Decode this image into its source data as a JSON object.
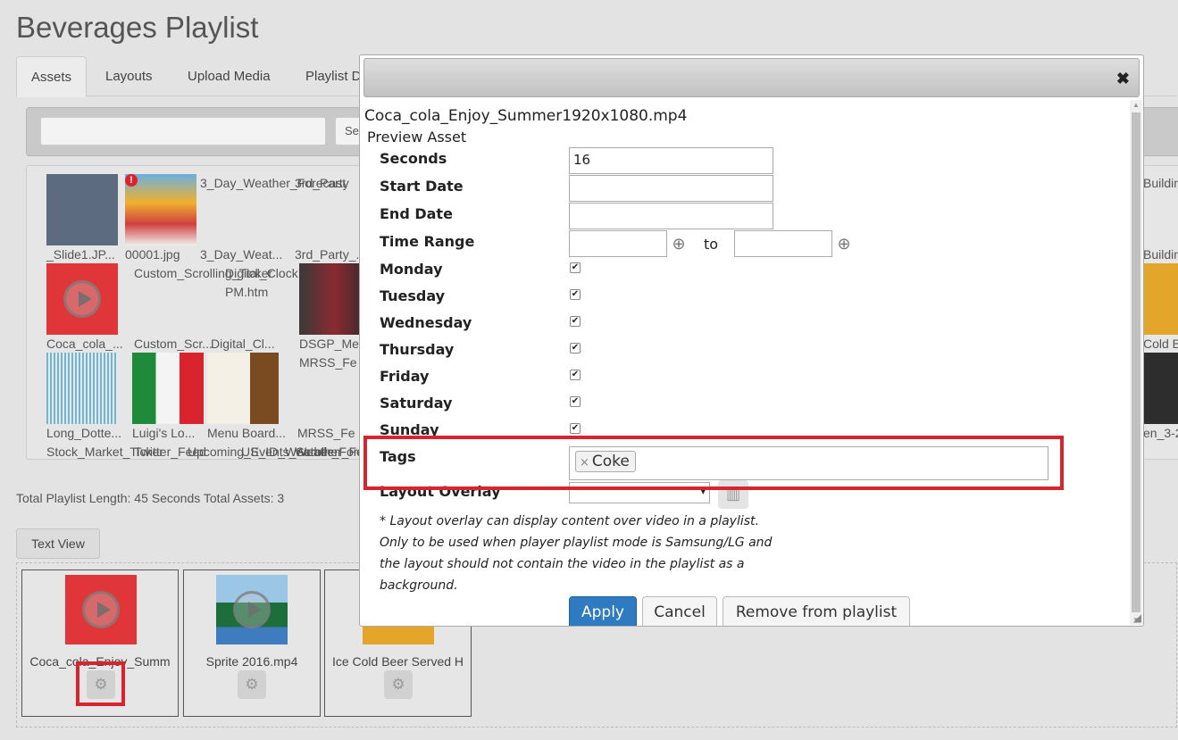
{
  "page": {
    "title": "Beverages Playlist"
  },
  "tabs": [
    "Assets",
    "Layouts",
    "Upload Media",
    "Playlist D"
  ],
  "search": {
    "button_label": "Se"
  },
  "library": {
    "labels": [
      "_Slide1.JP...",
      "00001.jpg",
      "3_Day_Weat...",
      "3_Day_Weather_Forecast",
      "3rd_Party_...",
      "3rd_Party",
      "Custom_Scrolling_Ticker",
      "Digital_Clock",
      "PM.htm",
      "Coca_cola_...",
      "Custom_Scr...",
      "Digital_Cl...",
      "DSGP_Me",
      "MRSS_Fe",
      "Long_Dotte...",
      "Luigi's Lo...",
      "Menu Board...",
      "MRSS_Fe",
      "Stock_Market_Ticker",
      "Twitter_Feed",
      "Upcoming_Events_Scroller",
      "US_ID_Weather_Forecast",
      "Weather_Fo",
      "Buildin",
      "Buildin",
      "Cold B",
      "en_3-2"
    ]
  },
  "summary": "Total Playlist Length: 45 Seconds Total Assets: 3",
  "text_view_button": "Text View",
  "playlist_items": [
    {
      "name": "Coca_cola_Enjoy_Summ",
      "thumb_color": "#e0363a"
    },
    {
      "name": "Sprite 2016.mp4",
      "thumb_color": "#3f7bbf"
    },
    {
      "name": "Ice Cold Beer Served H",
      "thumb_color": "#e3a62a"
    }
  ],
  "dialog": {
    "close_symbol": "✖",
    "filename": "Coca_cola_Enjoy_Summer1920x1080.mp4",
    "preview_label": "Preview Asset",
    "fields": {
      "seconds_label": "Seconds",
      "seconds_value": "16",
      "start_date_label": "Start Date",
      "start_date_value": "",
      "end_date_label": "End Date",
      "end_date_value": "",
      "time_range_label": "Time Range",
      "time_range_to": "to"
    },
    "days": [
      {
        "label": "Monday",
        "checked": true
      },
      {
        "label": "Tuesday",
        "checked": true
      },
      {
        "label": "Wednesday",
        "checked": true
      },
      {
        "label": "Thursday",
        "checked": true
      },
      {
        "label": "Friday",
        "checked": true
      },
      {
        "label": "Saturday",
        "checked": true
      },
      {
        "label": "Sunday",
        "checked": true
      }
    ],
    "tags_label": "Tags",
    "tags": [
      "Coke"
    ],
    "tag_remove_symbol": "×",
    "layout_overlay_label": "Layout Overlay",
    "note": "* Layout overlay can display content over video in a playlist. Only to be used when player playlist mode is Samsung/LG and the layout should not contain the video in the playlist as a background.",
    "buttons": {
      "apply": "Apply",
      "cancel": "Cancel",
      "remove": "Remove from playlist"
    }
  },
  "colors": {
    "accent": "#2f7bc1",
    "highlight": "#d9232d",
    "coke_red": "#e0363a"
  }
}
